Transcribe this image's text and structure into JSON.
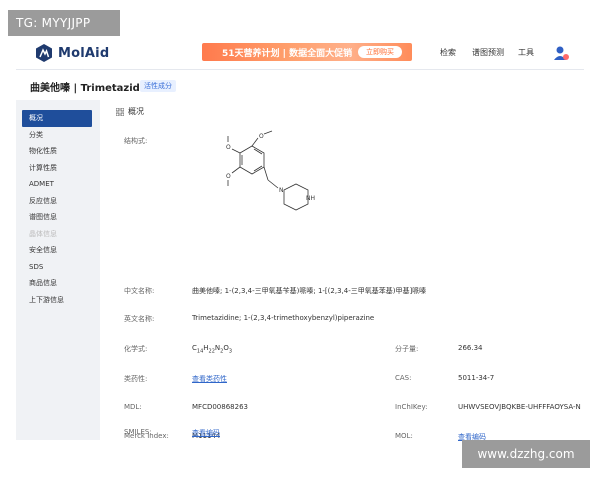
{
  "watermarks": {
    "top_left": "TG: MYYJJPP",
    "bottom_right": "www.dzzhg.com"
  },
  "header": {
    "logo_text": "MolAid",
    "banner_text": "51天营养计划 | 数据全面大促销",
    "banner_button": "立即购买",
    "nav": [
      "检索",
      "谱图预测",
      "工具"
    ]
  },
  "titlebar": {
    "title": "曲美他嗪 | Trimetazidine",
    "tag": "活性成分"
  },
  "sidebar": {
    "items": [
      {
        "label": "概况",
        "state": "active"
      },
      {
        "label": "分类",
        "state": "normal"
      },
      {
        "label": "物化性质",
        "state": "normal"
      },
      {
        "label": "计算性质",
        "state": "normal"
      },
      {
        "label": "ADMET",
        "state": "normal"
      },
      {
        "label": "反应信息",
        "state": "normal"
      },
      {
        "label": "谱图信息",
        "state": "normal"
      },
      {
        "label": "晶体信息",
        "state": "muted"
      },
      {
        "label": "安全信息",
        "state": "normal"
      },
      {
        "label": "SDS",
        "state": "normal"
      },
      {
        "label": "商品信息",
        "state": "normal"
      },
      {
        "label": "上下游信息",
        "state": "normal"
      }
    ]
  },
  "overview": {
    "heading": "概况",
    "structure_label": "结构式:",
    "structure_atoms": {
      "methoxy": "O",
      "nh": "NH",
      "n": "N"
    },
    "cn_name_label": "中文名称:",
    "cn_name": "曲美他嗪; 1-(2,3,4-三甲氧基苄基)哌嗪; 1-[(2,3,4-三甲氧基苯基)甲基]哌嗪",
    "en_name_label": "英文名称:",
    "en_name": "Trimetazidine; 1-(2,3,4-trimethoxybenzyl)piperazine",
    "formula_label": "化学式:",
    "formula": {
      "c": "C",
      "c_n": "14",
      "h": "H",
      "h_n": "22",
      "n": "N",
      "n_n": "2",
      "o": "O",
      "o_n": "3"
    },
    "mw_label": "分子量:",
    "mw": "266.34",
    "analog_label": "类药性:",
    "analog_link": "查看类药性",
    "cas_label": "CAS:",
    "cas": "5011-34-7",
    "mdl_label": "MDL:",
    "mdl": "MFCD00868263",
    "inchikey_label": "InChIKey:",
    "inchikey": "UHWVSEOVJBQKBE-UHFFFAOYSA-N",
    "merck_label": "Merck Index:",
    "merck": "M11144",
    "mol_label": "MOL:",
    "mol_link": "查看编码",
    "smiles_label": "SMILES:",
    "smiles_link": "查看编码"
  }
}
